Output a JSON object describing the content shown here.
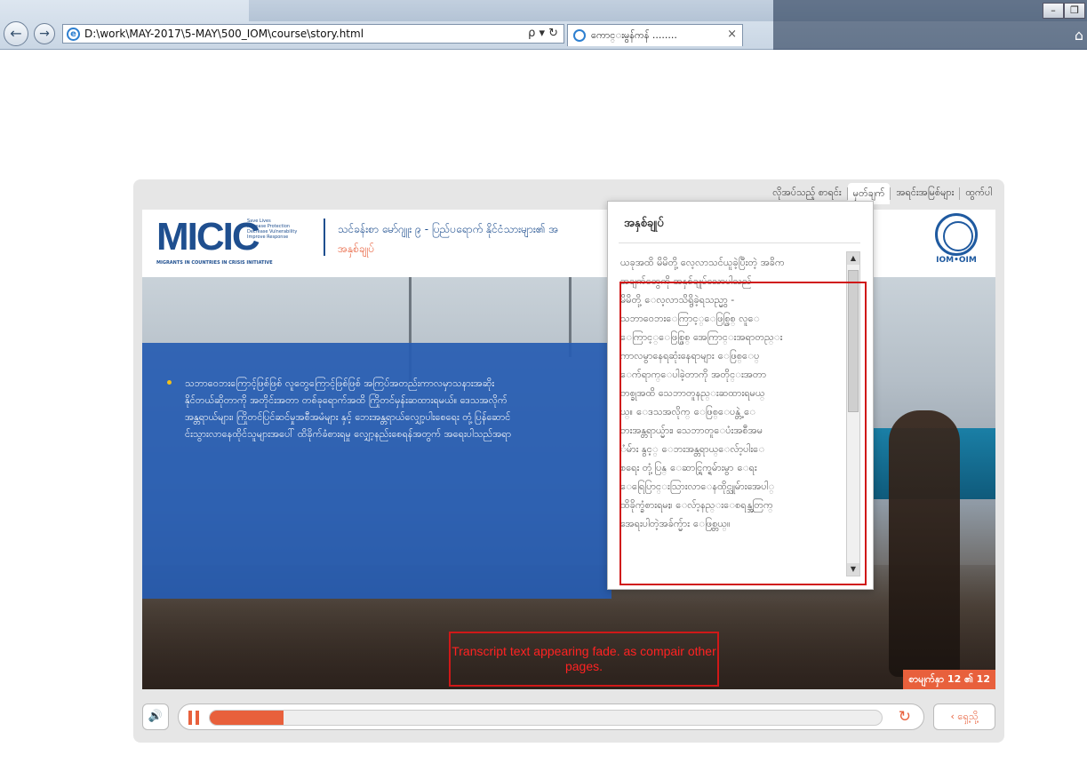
{
  "browser": {
    "address_url": "D:\\work\\MAY-2017\\5-MAY\\500_IOM\\course\\story.html",
    "tools": "ρ ▾ ↻",
    "tab_title": "ကောင္းမွန်ကန် ........",
    "tab_close": "×",
    "back": "←",
    "forward": "→"
  },
  "player": {
    "nav": [
      "လိုအပ်သည့် စာရင်း",
      "မှတ်ချက်",
      "အရင်းအမြစ်များ",
      "ထွက်ပါ"
    ],
    "logo_text": "MICIC",
    "logo_tagline": "Save Lives\nIncrease Protection\nDecrease Vulnerability\nImprove Response",
    "logo_subtitle": "MIGRANTS IN COUNTRIES IN CRISIS INITIATIVE",
    "course_title": "သင်ခန်းစာ မော်ဂျူး ၉ - ပြည်ပရောက် နိုင်ငံသားများ၏ အ",
    "slide_subtitle": "အနှစ်ချုပ်",
    "iom_name": "IOM•OIM",
    "bullet_text": "သဘာဝေဘးကြောင့်ဖြစ်ဖြစ် လူတွေကြောင့်ဖြစ်ဖြစ် အကြပ်အတည်းကာလမှာသနားအဆိုး\nနိုင်တယ်ဆိုတာကို အတိုင်းအတာ တစ်ခုရောက်အထိ ကြိုတင်မှန်းဆထားရမယ်။ ဒေသအလိုက်\nအန္တရာယ်များ၊ ကြိုတင်ပြင်ဆင်မှုအစီအမံများ နှင့် ဘေးအန္တရာယ်လျှော့ပါးစေရေး တုံ့ပြန်ဆောင်\nင်းသွားလာနေထိုင်သူများအပေါ် ထိခိုက်ခံစားရမှု လျှော့နည်းစေရန်အတွက် အရေးပါသည်အရာ",
    "page_counter": "စာမျက်နှာ 12 ၏ 12",
    "prev_label": "‹ ရှေ့သို့",
    "progress": 0.11
  },
  "transcript": {
    "title": "အနှစ်ချုပ်",
    "body": "ယခုအထိ မိမိတို့ လေ့လာသင်ယူခဲ့ပြီးတဲ့ အခိက\nအချက်တွေကို အနှစ်ချုပ်သောပါသည်\nမိမိတို့ ေလ့လာသိရွိခဲ့ရသည္မွာ -\nသဘာဝေဘးေကြာင့္ေဖြစ္ဖြစ္ လူေ\nေကြာင့္ေဖြစ္ဖြစ္ အေကြာင္းအရာတည္း\nကာလမွာနေရဆုံးနေရာများ ေဖြစ္ေပ္\nေက်ရာက္ေပါခဲ့တာကို အတိုင္းအတာ\nတစ္ခုအထိ သေဘာတူနည္းဆထားရမယ္\nယ္။ ေဒသအလိုက္ ေဖြစ္ေပန္တဲ့ ေ\nဘးအန္တရာယ္မ်ား၊ သေဘာတူေပံးအစီအမ\nံမ်ား နွင့္ ေဘးအန္တရာယ္ေလ်ာ့ပါးေ\nစရေး တုံ့ပြန္ ေဆာင္ရြက္ရမ်ားမွာ ေရး\nေရြေပြာင္းသြားလာေနထိုင္သူမ်ားအေပါ္\nထိခိုက္ခံစားရမႈ၊ ေလ်ာ့နည္းေစရန္အတြက္\nအေရးပါတဲ့အခ်က္မ်ား ေဖြစ္တယ္။"
  },
  "annotation": {
    "text": "Transcript text appearing fade. as compair other pages.",
    "color": "#d01818"
  },
  "colors": {
    "accent": "#e8603c",
    "brand_blue": "#1f4f8f",
    "panel_blue": "#265cb2"
  }
}
